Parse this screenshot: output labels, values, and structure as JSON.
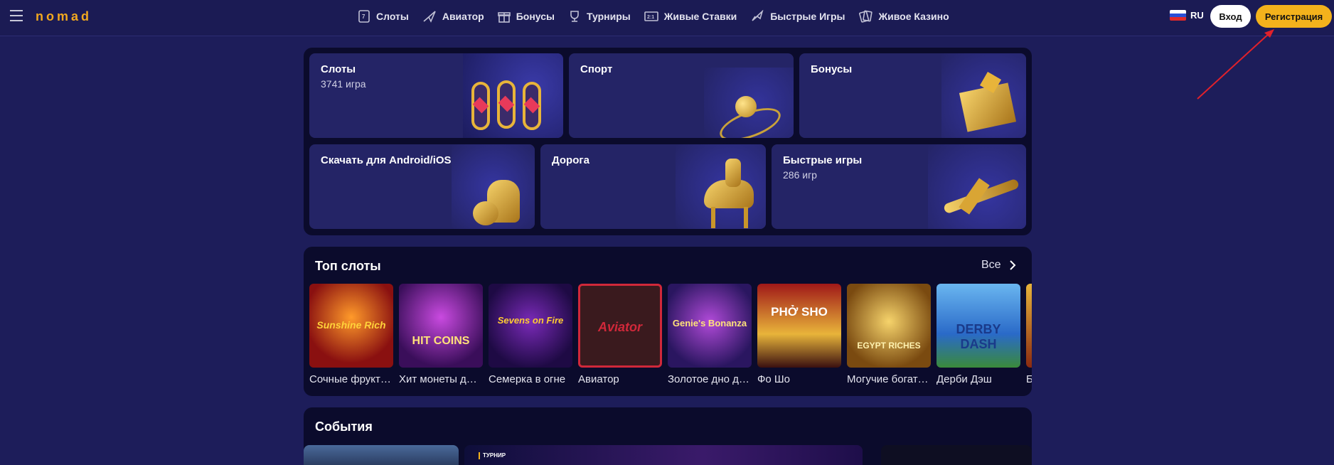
{
  "header": {
    "logo": "nomad",
    "nav": [
      {
        "label": "Слоты",
        "icon": "slots-icon"
      },
      {
        "label": "Авиатор",
        "icon": "plane-icon"
      },
      {
        "label": "Бонусы",
        "icon": "gift-icon"
      },
      {
        "label": "Турниры",
        "icon": "trophy-icon"
      },
      {
        "label": "Живые Ставки",
        "icon": "live-bets-icon"
      },
      {
        "label": "Быстрые Игры",
        "icon": "rocket-icon"
      },
      {
        "label": "Живое Казино",
        "icon": "cards-icon"
      }
    ],
    "language": "RU",
    "login_label": "Вход",
    "register_label": "Регистрация"
  },
  "categories": [
    {
      "title": "Слоты",
      "subtitle": "3741 игра"
    },
    {
      "title": "Спорт",
      "subtitle": ""
    },
    {
      "title": "Бонусы",
      "subtitle": ""
    },
    {
      "title": "Скачать для Android/iOS",
      "subtitle": ""
    },
    {
      "title": "Дорога",
      "subtitle": ""
    },
    {
      "title": "Быстрые игры",
      "subtitle": "286 игр"
    }
  ],
  "top_slots": {
    "title": "Топ слоты",
    "all_label": "Все",
    "items": [
      {
        "name": "Сочные фрукты: Солнечное богатство",
        "art": "Sunshine Rich"
      },
      {
        "name": "Хит монеты держи и крути",
        "art": "HIT COINS"
      },
      {
        "name": "Семерка в огне",
        "art": "Sevens on Fire"
      },
      {
        "name": "Авиатор",
        "art": "Aviator"
      },
      {
        "name": "Золотое дно джинна",
        "art": "Genie's Bonanza"
      },
      {
        "name": "Фо Шо",
        "art": "PHỞ SHO"
      },
      {
        "name": "Могучие богатства Египта",
        "art": "EGYPT RICHES"
      },
      {
        "name": "Дерби Дэш",
        "art": "DERBY DASH"
      },
      {
        "name": "Б",
        "art": ""
      }
    ]
  },
  "events": {
    "title": "События",
    "badge": "ТУРНИР"
  }
}
